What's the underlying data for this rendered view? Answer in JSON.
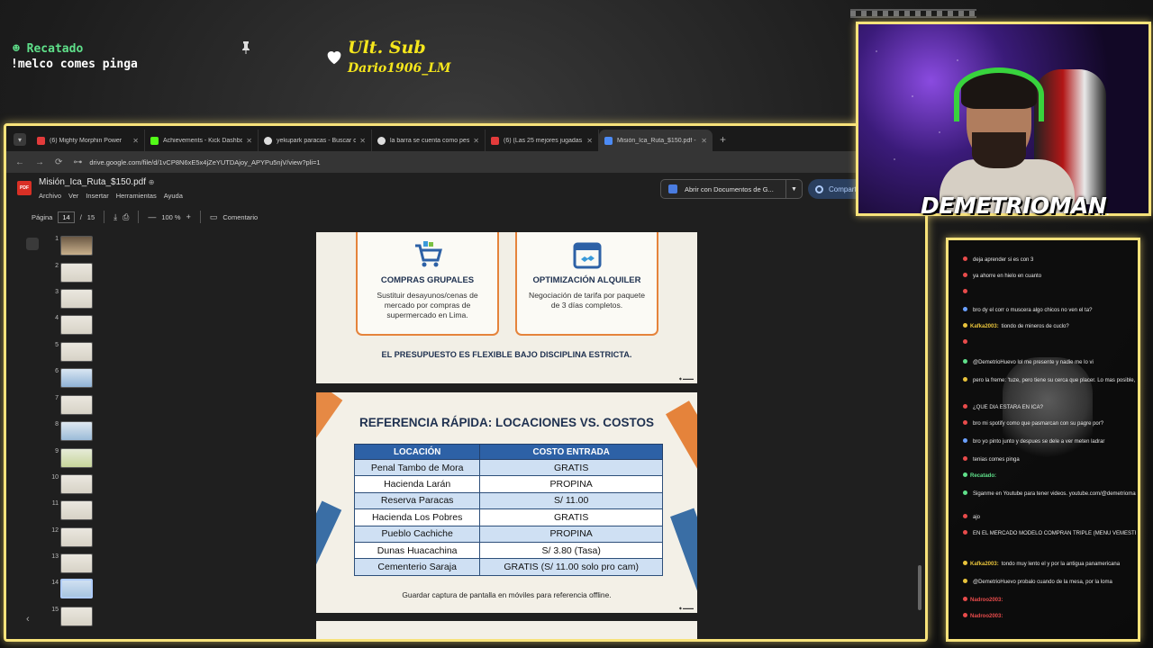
{
  "overlay": {
    "user": "Recatado",
    "message": "!melco comes pinga",
    "ult_sub_title": "Ult. Sub",
    "ult_sub_name": "Dario1906_LM"
  },
  "browser": {
    "tabs": [
      {
        "label": "(6) Mighty Morphin Power",
        "color": "#e33b3b"
      },
      {
        "label": "Achievements - Kick Dashboard",
        "color": "#53fc18"
      },
      {
        "label": "yekupark paracas - Buscar con",
        "color": "#dddddd"
      },
      {
        "label": "la barra se cuenta como peso",
        "color": "#dddddd"
      },
      {
        "label": "(6) (Las 25 mejores jugadas de",
        "color": "#e33b3b"
      },
      {
        "label": "Misión_Ica_Ruta_$150.pdf - Go",
        "color": "#4c8bf5",
        "active": true
      }
    ],
    "new_tab": "+",
    "url": "drive.google.com/file/d/1vCP8N6xE5x4jZeYUTDAjoy_APYPu5njV/view?pli=1"
  },
  "drive": {
    "file_title": "Misión_Ica_Ruta_$150.pdf",
    "menu": [
      "Archivo",
      "Ver",
      "Insertar",
      "Herramientas",
      "Ayuda"
    ],
    "open_with": "Abrir con Documentos de G...",
    "share": "Compartir",
    "toolbar": {
      "page_label": "Página",
      "page_current": "14",
      "page_sep": "/",
      "page_total": "15",
      "zoom_minus": "—",
      "zoom": "100 %",
      "zoom_plus": "+",
      "comment": "Comentario"
    },
    "thumbnails": [
      "1",
      "2",
      "3",
      "4",
      "5",
      "6",
      "7",
      "8",
      "9",
      "10",
      "11",
      "12",
      "13",
      "14",
      "15"
    ],
    "selected_thumbnail": 14
  },
  "slide13": {
    "cards": [
      {
        "title": "COMPRAS GRUPALES",
        "body": "Sustituir desayunos/cenas de mercado por compras de supermercado en Lima."
      },
      {
        "title": "OPTIMIZACIÓN ALQUILER",
        "body": "Negociación de tarifa por paquete de 3 días completos."
      }
    ],
    "footer": "EL PRESUPUESTO ES FLEXIBLE BAJO DISCIPLINA ESTRICTA."
  },
  "slide14": {
    "title": "REFERENCIA RÁPIDA: LOCACIONES VS. COSTOS",
    "headers": [
      "LOCACIÓN",
      "COSTO ENTRADA"
    ],
    "rows": [
      [
        "Penal Tambo de Mora",
        "GRATIS"
      ],
      [
        "Hacienda Larán",
        "PROPINA"
      ],
      [
        "Reserva Paracas",
        "S/ 11.00"
      ],
      [
        "Hacienda Los Pobres",
        "GRATIS"
      ],
      [
        "Pueblo Cachiche",
        "PROPINA"
      ],
      [
        "Dunas Huacachina",
        "S/ 3.80 (Tasa)"
      ],
      [
        "Cementerio Saraja",
        "GRATIS (S/ 11.00 solo pro cam)"
      ]
    ],
    "footer": "Guardar captura de pantalla en móviles para referencia offline."
  },
  "webcam": {
    "streamer_name": "DEMETRIOMAN",
    "name_suffix": "..."
  },
  "chat": {
    "messages": [
      {
        "user": "",
        "text": "deja aprender si es con 3",
        "color": "#e84b4b"
      },
      {
        "user": "",
        "text": "ya ahorre en hielo en cuanto",
        "color": "#e84b4b"
      },
      {
        "user": "",
        "text": "",
        "color": "#e84b4b"
      },
      {
        "user": "",
        "text": "bro dy el corr o muscera algo chicos no ven el ta?",
        "color": "#6aa0ff"
      },
      {
        "user": "Kafka2003",
        "text": "tiondo de mineros de cuclo?",
        "color": "#e8c33b"
      },
      {
        "user": "",
        "text": "",
        "color": "#e84b4b"
      },
      {
        "user": "",
        "text": "@DemetrioHuevo lol me presente y nadie me lo vi",
        "color": "#5fe08a"
      },
      {
        "user": "",
        "text": "pero la freme: 'tuze, pero tiene su cerca que placer. Lo mas posible, pero siempre es bueno darle una revision manual para regresar",
        "color": "#e8c33b"
      },
      {
        "user": "",
        "text": "¿QUE DIA ESTARA EN ICA?",
        "color": "#e84b4b"
      },
      {
        "user": "",
        "text": "bro mi spotify como que pasmarcan con su pagre por?",
        "color": "#e84b4b"
      },
      {
        "user": "",
        "text": "bro yo pinto junto y despues se dele a ver meten ladrar",
        "color": "#6aa0ff"
      },
      {
        "user": "",
        "text": "tenias comes pinga",
        "color": "#e84b4b"
      },
      {
        "user": "Recatado",
        "text": "",
        "color": "#5fe08a"
      },
      {
        "user": "",
        "text": "Siganme en Youtube para tener videos. youtube.com/@demetrioman",
        "color": "#5fe08a"
      },
      {
        "user": "",
        "text": "ajo",
        "color": "#e84b4b"
      },
      {
        "user": "",
        "text": "EN EL MERCADO MODELO COMPRAN TRIPLE (MENU VEMESTRA CARNE FIEOS CON CEBADA Y CALDO) A 15 SOLES Y TIENEN PARA LA CENA",
        "color": "#e84b4b"
      },
      {
        "user": "Kafka2003",
        "text": "tondo muy lento el y por la antigua panamericana",
        "color": "#e8c33b"
      },
      {
        "user": "",
        "text": "@DemetrioHuevo probalo cuando de la mesa, por la loma",
        "color": "#e8c33b"
      },
      {
        "user": "Nadroo2003",
        "text": "",
        "color": "#e84b4b"
      },
      {
        "user": "Nadroo2003",
        "text": "",
        "color": "#e84b4b"
      }
    ]
  }
}
